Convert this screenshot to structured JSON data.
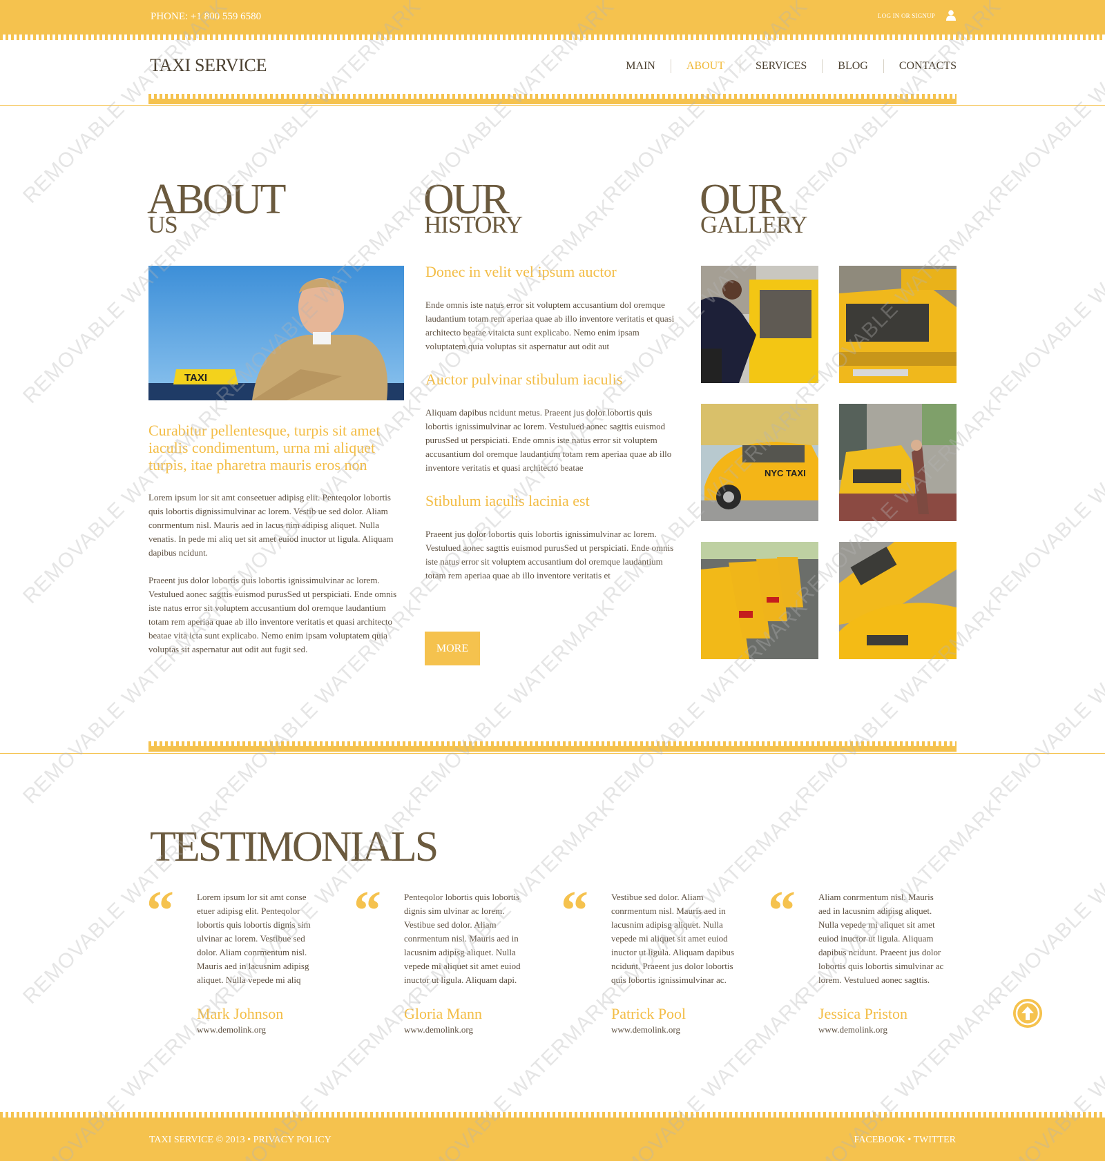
{
  "topbar": {
    "phone": "PHONE:  +1 800 559 6580",
    "login": "LOG IN OR SIGNUP"
  },
  "header": {
    "logo": "TAXI SERVICE",
    "nav": [
      {
        "label": "MAIN",
        "active": false
      },
      {
        "label": "ABOUT",
        "active": true
      },
      {
        "label": "SERVICES",
        "active": false
      },
      {
        "label": "BLOG",
        "active": false
      },
      {
        "label": "CONTACTS",
        "active": false
      }
    ]
  },
  "about": {
    "title_big": "ABOUT",
    "title_small": "US",
    "lead": "Curabitur pellentesque, turpis sit amet iaculis condimentum, urna mi aliquet turpis, itae pharetra mauris eros non",
    "para1": "Lorem ipsum lor sit amt conseetuer adipisg elit. Penteqolor lobortis quis lobortis dignissimulvinar ac lorem. Vestib ue sed dolor. Aliam conrmentum nisl. Mauris aed in lacus nim adipisg aliquet. Nulla venatis. In pede mi aliq uet sit amet euiod inuctor ut ligula. Aliquam dapibus ncidunt.",
    "para2": "Praeent jus dolor lobortis quis lobortis ignissimulvinar ac lorem. Vestulued aonec sagttis euismod purusSed ut perspiciati. Ende omnis iste natus error sit voluptem accusantium dol oremque laudantium totam rem aperiaa quae ab illo inventore veritatis et quasi architecto beatae vita icta sunt explicabo. Nemo enim ipsam voluptatem quia voluptas sit aspernatur aut odit aut fugit sed."
  },
  "history": {
    "title_big": "OUR",
    "title_small": "HISTORY",
    "items": [
      {
        "heading": "Donec in velit vel ipsum auctor",
        "text": "Ende omnis iste natus error sit voluptem accusantium dol oremque laudantium totam rem aperiaa quae ab illo inventore veritatis et quasi architecto beatae vitaicta sunt explicabo. Nemo enim ipsam voluptatem quia voluptas sit aspernatur aut odit aut"
      },
      {
        "heading": "Auctor pulvinar stibulum iaculis",
        "text": "Aliquam dapibus ncidunt metus. Praeent jus dolor lobortis quis lobortis ignissimulvinar ac lorem. Vestulued aonec sagttis euismod purusSed ut perspiciati. Ende omnis iste natus error sit voluptem accusantium dol oremque laudantium totam rem aperiaa quae ab illo inventore veritatis et quasi architecto beatae"
      },
      {
        "heading": "Stibulum iaculis lacinia est",
        "text": "Praeent jus dolor lobortis quis lobortis ignissimulvinar ac lorem. Vestulued aonec sagttis euismod purusSed ut perspiciati. Ende omnis iste natus error sit voluptem accusantium dol oremque laudantium totam rem aperiaa quae ab illo inventore veritatis et"
      }
    ],
    "more_label": "MORE"
  },
  "gallery": {
    "title_big": "OUR",
    "title_small": "GALLERY"
  },
  "testimonials": {
    "title": "TESTIMONIALS",
    "quote_glyph": "“",
    "items": [
      {
        "text": "Lorem ipsum lor sit amt conse etuer adipisg elit. Penteqolor lobortis quis lobortis dignis sim ulvinar ac lorem. Vestibue sed dolor. Aliam conrmentum nisl. Mauris aed in lacusnim adipisg aliquet. Nulla vepede mi aliq",
        "name": "Mark Johnson",
        "site": "www.demolink.org"
      },
      {
        "text": "Penteqolor lobortis quis lobortis dignis sim ulvinar ac lorem. Vestibue sed dolor. Aliam conrmentum nisl. Mauris aed in lacusnim adipisg aliquet. Nulla vepede mi aliquet sit amet euiod inuctor ut ligula. Aliquam dapi.",
        "name": "Gloria Mann",
        "site": "www.demolink.org"
      },
      {
        "text": "Vestibue sed dolor. Aliam conrmentum nisl. Mauris aed in lacusnim adipisg aliquet. Nulla vepede mi aliquet sit amet euiod inuctor ut ligula. Aliquam dapibus ncidunt. Praeent jus dolor lobortis quis lobortis ignissimulvinar ac.",
        "name": "Patrick Pool",
        "site": "www.demolink.org"
      },
      {
        "text": "Aliam conrmentum nisl. Mauris aed in lacusnim adipisg aliquet. Nulla vepede mi aliquet sit amet euiod inuctor ut ligula. Aliquam dapibus ncidunt. Praeent jus dolor lobortis quis lobortis simulvinar ac lorem. Vestulued aonec sagttis.",
        "name": "Jessica Priston",
        "site": "www.demolink.org"
      }
    ]
  },
  "footer": {
    "left": "TAXI SERVICE © 2013 • PRIVACY POLICY",
    "right": "FACEBOOK • TWITTER"
  },
  "watermark": "REMOVABLE WATERMARK",
  "colors": {
    "accent": "#f5c24e",
    "heading": "#6b5a3e",
    "text": "#5e5040"
  }
}
